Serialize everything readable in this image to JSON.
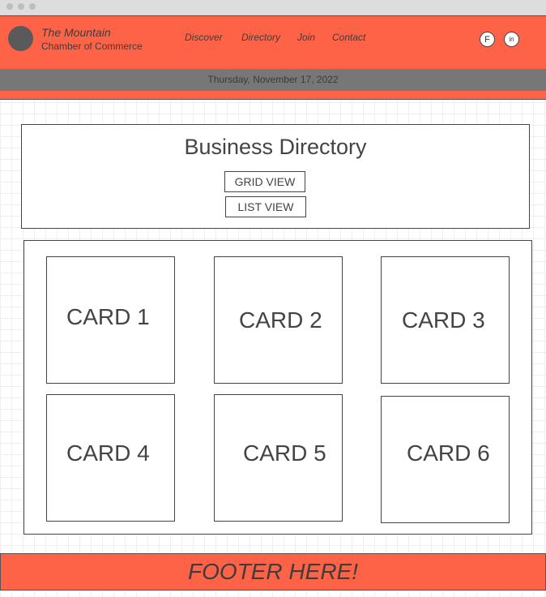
{
  "header": {
    "brand_title": "The Mountain",
    "brand_subtitle": "Chamber of Commerce",
    "nav": [
      "Discover",
      "Directory",
      "Join",
      "Contact"
    ],
    "social": [
      {
        "label": "F",
        "icon": "facebook-icon"
      },
      {
        "label": "in",
        "icon": "linkedin-icon"
      }
    ]
  },
  "date_bar": {
    "text": "Thursday, November 17, 2022"
  },
  "directory": {
    "title": "Business Directory",
    "grid_view_label": "GRID VIEW",
    "list_view_label": "LIST VIEW"
  },
  "cards": [
    "CARD 1",
    "CARD 2",
    "CARD 3",
    "CARD 4",
    "CARD 5",
    "CARD 6"
  ],
  "footer": {
    "text": "FOOTER HERE!"
  },
  "colors": {
    "accent": "#ff6347",
    "date_bar": "#777777",
    "text": "#444444"
  }
}
